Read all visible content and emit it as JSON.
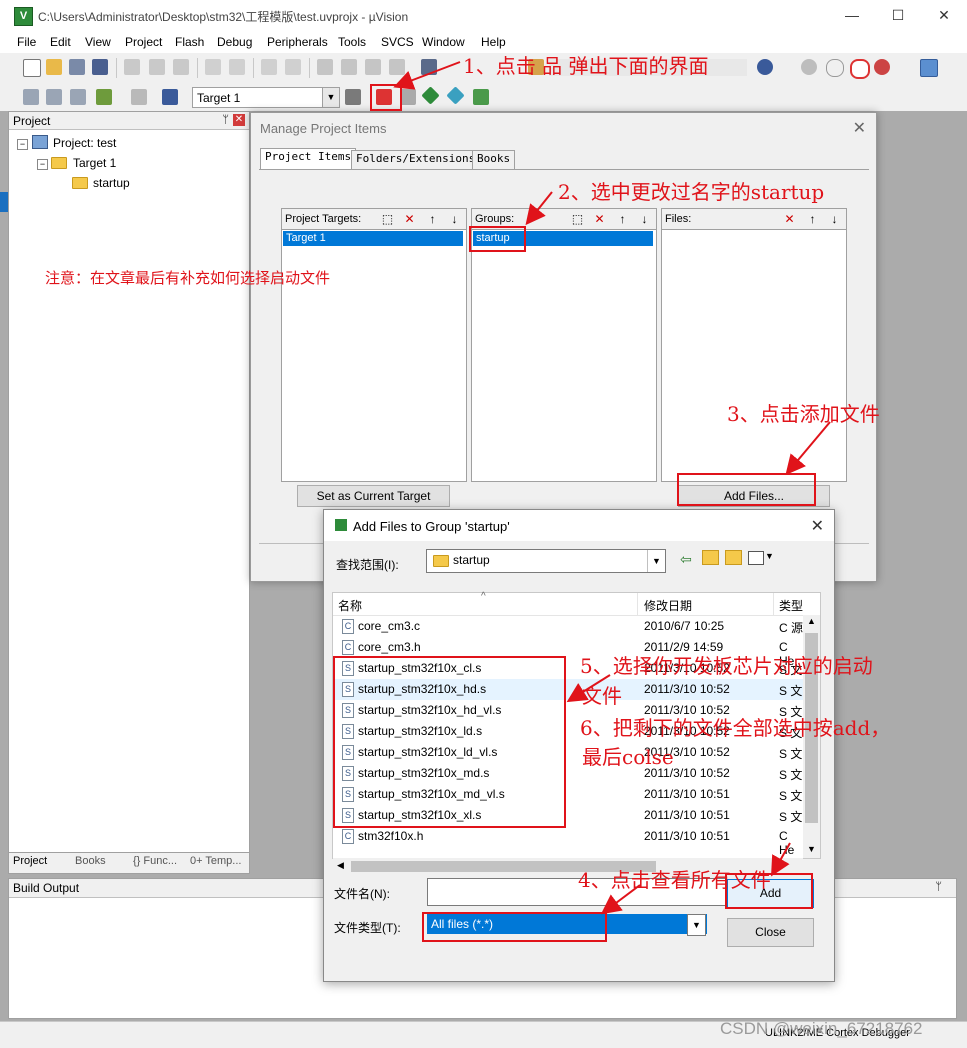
{
  "window": {
    "title": "C:\\Users\\Administrator\\Desktop\\stm32\\工程模版\\test.uvprojx - µVision",
    "app_icon": "V"
  },
  "menu": [
    "File",
    "Edit",
    "View",
    "Project",
    "Flash",
    "Debug",
    "Peripherals",
    "Tools",
    "SVCS",
    "Window",
    "Help"
  ],
  "toolbar2": {
    "target": "Target 1"
  },
  "project_panel": {
    "title": "Project",
    "tree": {
      "project": "Project: test",
      "target": "Target 1",
      "group": "startup"
    },
    "tabs": [
      "Project",
      "Books",
      "{} Func...",
      "0+ Temp..."
    ]
  },
  "build_output": {
    "title": "Build Output"
  },
  "manage_dialog": {
    "title": "Manage Project Items",
    "tabs": [
      "Project Items",
      "Folders/Extensions",
      "Books"
    ],
    "targets_label": "Project Targets:",
    "targets": [
      "Target 1"
    ],
    "groups_label": "Groups:",
    "groups": [
      "startup"
    ],
    "files_label": "Files:",
    "set_current_button": "Set as Current Target",
    "add_files_button": "Add Files..."
  },
  "add_dialog": {
    "title": "Add Files to Group 'startup'",
    "lookin_label": "查找范围(I):",
    "lookin_value": "startup",
    "columns": {
      "name": "名称",
      "date": "修改日期",
      "type": "类型"
    },
    "files": [
      {
        "name": "core_cm3.c",
        "date": "2010/6/7 10:25",
        "type": "C 源",
        "kind": "C"
      },
      {
        "name": "core_cm3.h",
        "date": "2011/2/9 14:59",
        "type": "C He",
        "kind": "C"
      },
      {
        "name": "startup_stm32f10x_cl.s",
        "date": "2011/3/10 10:52",
        "type": "S 文",
        "kind": "S"
      },
      {
        "name": "startup_stm32f10x_hd.s",
        "date": "2011/3/10 10:52",
        "type": "S 文",
        "kind": "S"
      },
      {
        "name": "startup_stm32f10x_hd_vl.s",
        "date": "2011/3/10 10:52",
        "type": "S 文",
        "kind": "S"
      },
      {
        "name": "startup_stm32f10x_ld.s",
        "date": "2011/3/10 10:52",
        "type": "S 文",
        "kind": "S"
      },
      {
        "name": "startup_stm32f10x_ld_vl.s",
        "date": "2011/3/10 10:52",
        "type": "S 文",
        "kind": "S"
      },
      {
        "name": "startup_stm32f10x_md.s",
        "date": "2011/3/10 10:52",
        "type": "S 文",
        "kind": "S"
      },
      {
        "name": "startup_stm32f10x_md_vl.s",
        "date": "2011/3/10 10:51",
        "type": "S 文",
        "kind": "S"
      },
      {
        "name": "startup_stm32f10x_xl.s",
        "date": "2011/3/10 10:51",
        "type": "S 文",
        "kind": "S"
      },
      {
        "name": "stm32f10x.h",
        "date": "2011/3/10 10:51",
        "type": "C He",
        "kind": "C"
      }
    ],
    "filename_label": "文件名(N):",
    "filename_value": "",
    "filetype_label": "文件类型(T):",
    "filetype_value": "All files (*.*)",
    "add_button": "Add",
    "close_button": "Close"
  },
  "annotations": {
    "step1": "1、点击 品 弹出下面的界面",
    "step2": "2、选中更改过名字的startup",
    "step3": "3、点击添加文件",
    "step4": "4、点击查看所有文件",
    "step5_line1": "5、选择你开发板芯片对应的启动",
    "step5_line2": "文件",
    "step6_line1": "6、把剩下的文件全部选中按add，",
    "step6_line2": "最后colse",
    "note": "注意：在文章最后有补充如何选择启动文件"
  },
  "status": {
    "debugger": "ULINK2/ME Cortex Debugger"
  },
  "watermark": "CSDN @weixin_67218762",
  "colors": {
    "annotation": "#e0131a",
    "selection": "#0078d7",
    "folder": "#f5c94a"
  }
}
